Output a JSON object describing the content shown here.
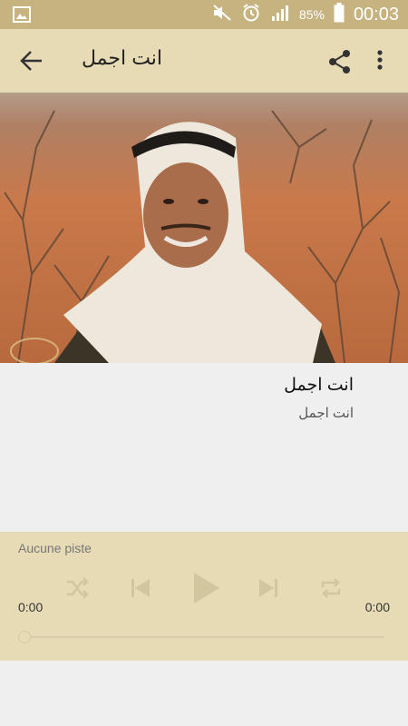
{
  "status_bar": {
    "battery_percent": "85%",
    "time": "00:03",
    "icons": [
      "gallery-icon",
      "mute-icon",
      "alarm-icon",
      "signal-icon",
      "battery-icon"
    ]
  },
  "app_bar": {
    "title": "انت اجمل",
    "icons": [
      "back-arrow-icon",
      "share-icon",
      "more-vert-icon"
    ]
  },
  "track": {
    "title": "انت اجمل",
    "subtitle": "انت اجمل"
  },
  "player": {
    "status": "Aucune piste",
    "elapsed": "0:00",
    "duration": "0:00",
    "progress": 0,
    "icons": [
      "shuffle-icon",
      "skip-previous-icon",
      "play-icon",
      "skip-next-icon",
      "repeat-icon"
    ]
  },
  "colors": {
    "status_bar": "#c6b37f",
    "app_bar": "#e6dbb5",
    "background": "#efefef"
  }
}
